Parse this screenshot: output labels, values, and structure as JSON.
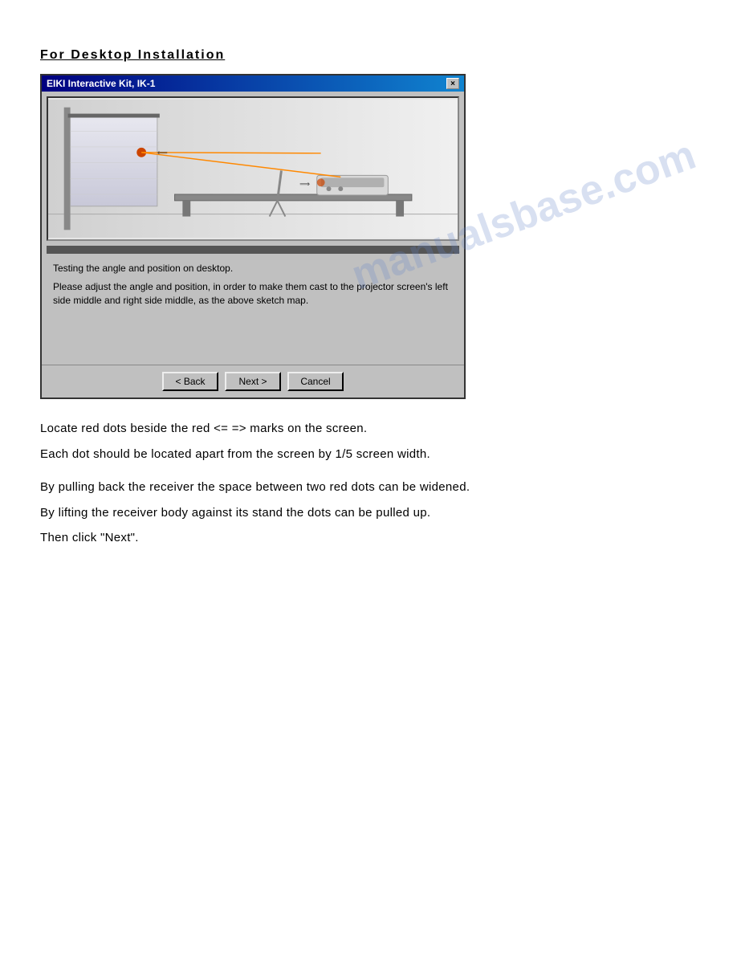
{
  "page": {
    "heading": "For  Desktop  Installation",
    "watermark": "manualsbase.com",
    "dialog": {
      "title": "EIKI Interactive Kit, IK-1",
      "close_label": "×",
      "illustration_text": "",
      "description_line1": "Testing the angle and position on desktop.",
      "description_line2": "Please adjust the angle and position, in order to make them cast to the projector screen's left side middle and right side middle, as the above sketch map.",
      "buttons": {
        "back": "< Back",
        "next": "Next >",
        "cancel": "Cancel"
      }
    },
    "body_paragraphs": [
      {
        "lines": [
          "Locate  red  dots  beside  the  red  <=      =>  marks  on  the  screen.",
          "Each  dot  should  be  located  apart  from  the  screen  by  1/5  screen  width."
        ]
      },
      {
        "lines": [
          "By  pulling  back  the  receiver  the  space  between  two  red  dots  can  be  widened.",
          "By  lifting  the  receiver  body  against  its  stand  the  dots  can  be  pulled  up.",
          "Then  click  \"Next\"."
        ]
      }
    ]
  }
}
